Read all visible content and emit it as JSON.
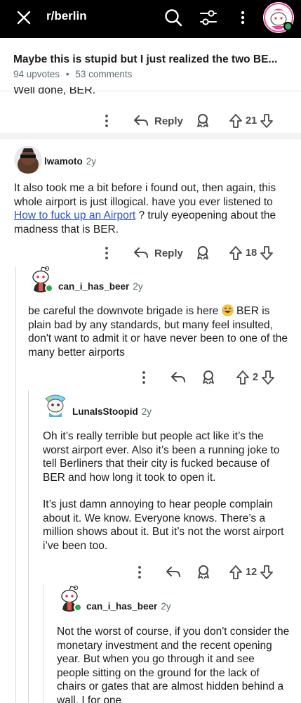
{
  "topbar": {
    "subreddit": "r/berlin"
  },
  "post": {
    "title": "Maybe this is stupid but I just realized the two BE...",
    "upvotes": "94 upvotes",
    "dot": "•",
    "comments": "53 comments"
  },
  "prev_comment": {
    "text_tail": "Well done, BER.",
    "reply_label": "Reply",
    "score": "21"
  },
  "comments": [
    {
      "user": "lwamoto",
      "age": "2y",
      "body_before_link": "It also took me a bit before i found out, then again, this whole airport is just illogical. have you ever listened to ",
      "link_text": "How to fuck up an Airport",
      "body_after_link": " ? truly eyeopening about the madness that is BER.",
      "reply_label": "Reply",
      "score": "18"
    },
    {
      "user": "can_i_has_beer",
      "age": "2y",
      "body_before_emoji": "be careful the downvote brigade is here ",
      "body_after_emoji": " BER is plain bad by any standards, but many feel insulted, don't want to admit it or have never been to one of the many better airports",
      "score": "2"
    },
    {
      "user": "LunaIsStoopid",
      "age": "2y",
      "para1": "Oh it’s really terrible but people act like it’s the worst airport ever. Also it’s been a running joke to tell Berliners that their city is fucked because of BER and how long it took to open it.",
      "para2": "It’s just damn annoying to hear people complain about it. We know. Everyone knows. There’s a million shows about it. But it’s not the worst airport i’ve been too.",
      "score": "12"
    },
    {
      "user": "can_i_has_beer",
      "age": "2y",
      "body": "Not the worst of course, if you don't consider the monetary investment and the recent opening year. But when you go through it and see people sitting on the ground for the lack of chairs or gates that are almost hidden behind a wall, I for one"
    }
  ],
  "icons": {
    "close": "close-icon",
    "search": "search-icon",
    "filter": "sort-filter-icon",
    "more": "more-vertical-icon",
    "reply": "reply-arrow-icon",
    "award": "award-icon",
    "upvote": "upvote-arrow-icon",
    "downvote": "downvote-arrow-icon"
  },
  "colors": {
    "topbar_bg": "#000000",
    "link": "#2f54d1",
    "meta": "#576f76",
    "online": "#2fa84f"
  }
}
